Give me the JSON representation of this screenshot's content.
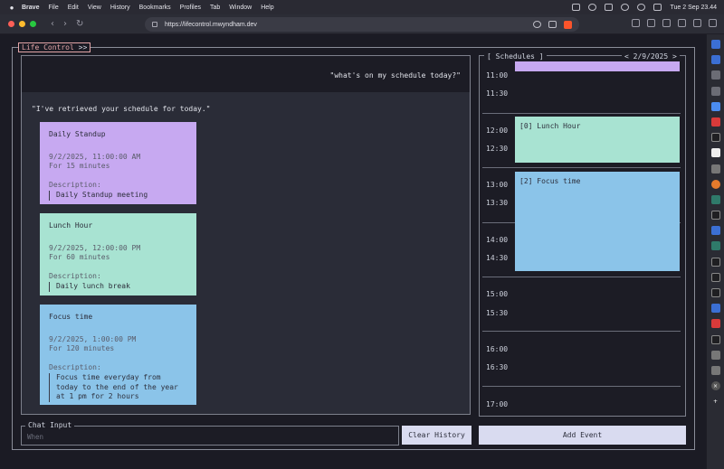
{
  "menubar": {
    "app_name": "Brave",
    "items": [
      "File",
      "Edit",
      "View",
      "History",
      "Bookmarks",
      "Profiles",
      "Tab",
      "Window",
      "Help"
    ],
    "clock": "Tue 2 Sep 23.44"
  },
  "browser": {
    "url": "https://lifecontrol.mwyndham.dev"
  },
  "app": {
    "title": "Life Control",
    "title_suffix": ">>"
  },
  "chat": {
    "user_message": "\"what's on my schedule today?\"",
    "bot_message": "\"I've retrieved your schedule for today.\"",
    "cards": [
      {
        "title": "Daily Standup",
        "datetime": "9/2/2025, 11:00:00 AM",
        "duration": "For 15 minutes",
        "desc_label": "Description:",
        "description": "Daily Standup meeting",
        "color": "#c7a9f1"
      },
      {
        "title": "Lunch Hour",
        "datetime": "9/2/2025, 12:00:00 PM",
        "duration": "For 60 minutes",
        "desc_label": "Description:",
        "description": "Daily lunch break",
        "color": "#a8e3d2"
      },
      {
        "title": "Focus time",
        "datetime": "9/2/2025, 1:00:00 PM",
        "duration": "For 120 minutes",
        "desc_label": "Description:",
        "description": "Focus time everyday from today to the end of the year at 1 pm for 2 hours",
        "color": "#8bc4e9"
      }
    ]
  },
  "schedule": {
    "label": "[ Schedules ]",
    "date_nav": "< 2/9/2025 >",
    "times": [
      "11:00",
      "11:30",
      "12:00",
      "12:30",
      "13:00",
      "13:30",
      "14:00",
      "14:30",
      "15:00",
      "15:30",
      "16:00",
      "16:30",
      "17:00"
    ],
    "events": [
      {
        "label": "",
        "color": "#c7a9f1"
      },
      {
        "label": "[0] Lunch Hour",
        "color": "#a8e3d2"
      },
      {
        "label": "[2] Focus time",
        "color": "#8bc4e9"
      }
    ]
  },
  "controls": {
    "chat_input_label": "Chat Input",
    "chat_input_placeholder": "When",
    "chat_input_value": "",
    "clear_history": "Clear History",
    "add_event": "Add Event"
  }
}
